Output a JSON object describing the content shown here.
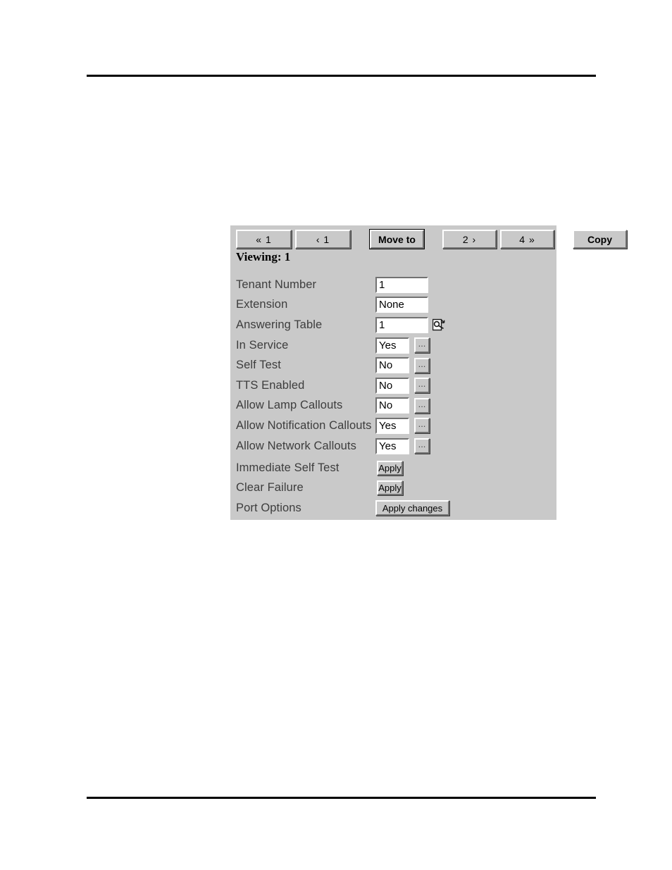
{
  "page": {
    "background_color": "#ffffff",
    "rule_color": "#000000"
  },
  "panel": {
    "background_color": "#c9c9c9",
    "viewing_label": "Viewing: 1"
  },
  "toolbar": {
    "first_label": "« 1",
    "prev_label": "‹ 1",
    "move_to_label": "Move to",
    "next_label": "2 ›",
    "last_label": "4 »",
    "copy_label": "Copy"
  },
  "form": {
    "ellipsis_label": "...",
    "rows": [
      {
        "label": "Tenant Number",
        "value": "1",
        "type": "text"
      },
      {
        "label": "Extension",
        "value": "None",
        "type": "text"
      },
      {
        "label": "Answering Table",
        "value": "1",
        "type": "text-lookup"
      },
      {
        "label": "In Service",
        "value": "Yes",
        "type": "picker"
      },
      {
        "label": "Self Test",
        "value": "No",
        "type": "picker"
      },
      {
        "label": "TTS Enabled",
        "value": "No",
        "type": "picker"
      },
      {
        "label": "Allow Lamp Callouts",
        "value": "No",
        "type": "picker"
      },
      {
        "label": "Allow Notification Callouts",
        "value": "Yes",
        "type": "picker"
      },
      {
        "label": "Allow Network Callouts",
        "value": "Yes",
        "type": "picker"
      }
    ]
  },
  "actions": {
    "rows": [
      {
        "label": "Immediate Self Test",
        "button": "Apply",
        "size": "small"
      },
      {
        "label": "Clear Failure",
        "button": "Apply",
        "size": "small"
      },
      {
        "label": "Port Options",
        "button": "Apply changes",
        "size": "wide"
      }
    ]
  },
  "icons": {
    "lookup": "lookup-cursor-icon"
  }
}
